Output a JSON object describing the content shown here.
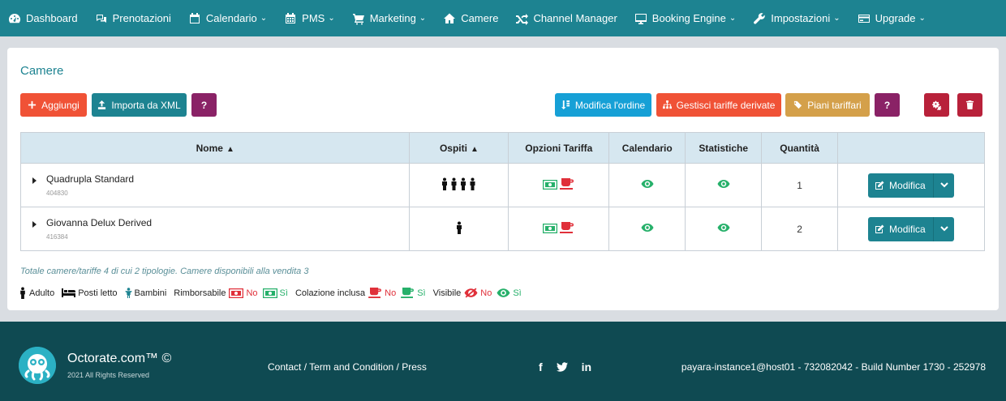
{
  "nav": {
    "items": [
      {
        "label": "Dashboard",
        "icon": "dashboard-icon",
        "caret": false
      },
      {
        "label": "Prenotazioni",
        "icon": "chat-icon",
        "caret": false
      },
      {
        "label": "Calendario",
        "icon": "calendar-icon",
        "caret": true
      },
      {
        "label": "PMS",
        "icon": "calendar-grid-icon",
        "caret": true
      },
      {
        "label": "Marketing",
        "icon": "cart-icon",
        "caret": true
      },
      {
        "label": "Camere",
        "icon": "home-icon",
        "caret": false
      },
      {
        "label": "Channel Manager",
        "icon": "shuffle-icon",
        "caret": false
      },
      {
        "label": "Booking Engine",
        "icon": "monitor-icon",
        "caret": true
      },
      {
        "label": "Impostazioni",
        "icon": "wrench-icon",
        "caret": true
      },
      {
        "label": "Upgrade",
        "icon": "card-icon",
        "caret": true
      }
    ]
  },
  "page": {
    "title": "Camere"
  },
  "toolbar": {
    "add": "Aggiungi",
    "import_xml": "Importa da XML",
    "help": "?",
    "modify_order": "Modifica l'ordine",
    "manage_derived": "Gestisci tariffe derivate",
    "rate_plans": "Piani tariffari",
    "help2": "?"
  },
  "table": {
    "headers": {
      "name": "Nome",
      "guests": "Ospiti",
      "rate_options": "Opzioni Tariffa",
      "calendar": "Calendario",
      "stats": "Statistiche",
      "quantity": "Quantità"
    },
    "rows": [
      {
        "name": "Quadrupla Standard",
        "id": "404830",
        "guests": 4,
        "quantity": "1",
        "action": "Modifica"
      },
      {
        "name": "Giovanna Delux Derived",
        "id": "416384",
        "guests": 1,
        "quantity": "2",
        "action": "Modifica"
      }
    ]
  },
  "footnote": "Totale camere/tariffe 4 di cui 2 tipologie. Camere disponibili alla vendita 3",
  "legend": {
    "adult": "Adulto",
    "beds": "Posti letto",
    "children": "Bambini",
    "refundable": "Rimborsabile",
    "no": "No",
    "yes": "Sì",
    "breakfast": "Colazione inclusa",
    "visible": "Visibile"
  },
  "colors": {
    "primary": "#1d8391",
    "danger": "#f05236",
    "green": "#26b06a",
    "red": "#e0303a"
  },
  "footer": {
    "brand": "Octorate.com™ ©",
    "rights": "2021 All Rights Reserved",
    "links": "Contact / Term and Condition / Press",
    "social": [
      "f",
      "t",
      "in"
    ],
    "build": "payara-instance1@host01 - 732082042 - Build Number 1730 - 252978"
  }
}
